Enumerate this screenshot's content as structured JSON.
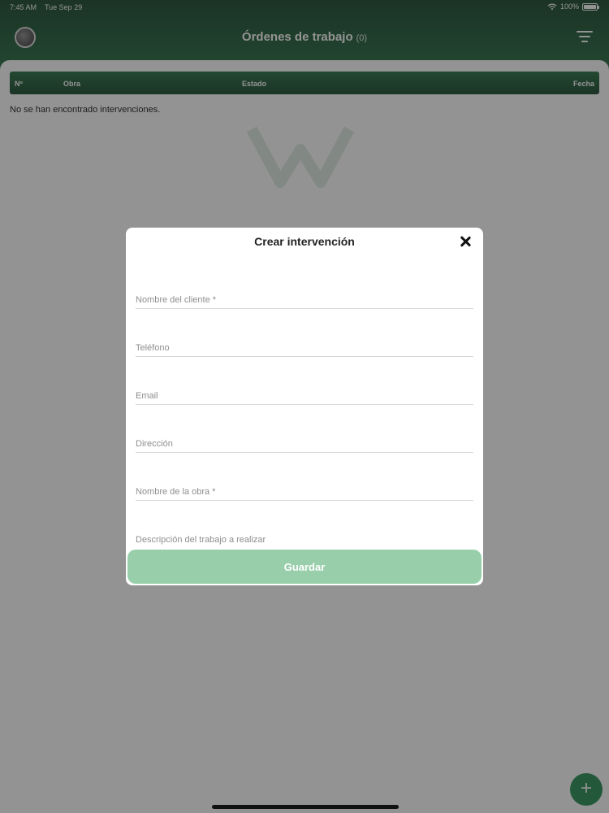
{
  "status_bar": {
    "time": "7:45 AM",
    "date": "Tue Sep 29",
    "battery": "100%"
  },
  "header": {
    "title": "Órdenes de trabajo",
    "count": "(0)"
  },
  "table": {
    "columns": [
      "Nº",
      "Obra",
      "Estado",
      "Fecha"
    ]
  },
  "empty_message": "No se han encontrado intervenciones.",
  "modal": {
    "title": "Crear intervención",
    "fields": [
      {
        "placeholder": "Nombre del cliente *"
      },
      {
        "placeholder": "Teléfono"
      },
      {
        "placeholder": "Email"
      },
      {
        "placeholder": "Dirección"
      },
      {
        "placeholder": "Nombre de la obra *"
      },
      {
        "placeholder": "Descripción del trabajo a realizar"
      }
    ],
    "save_label": "Guardar"
  },
  "fab": {
    "label": "+"
  }
}
